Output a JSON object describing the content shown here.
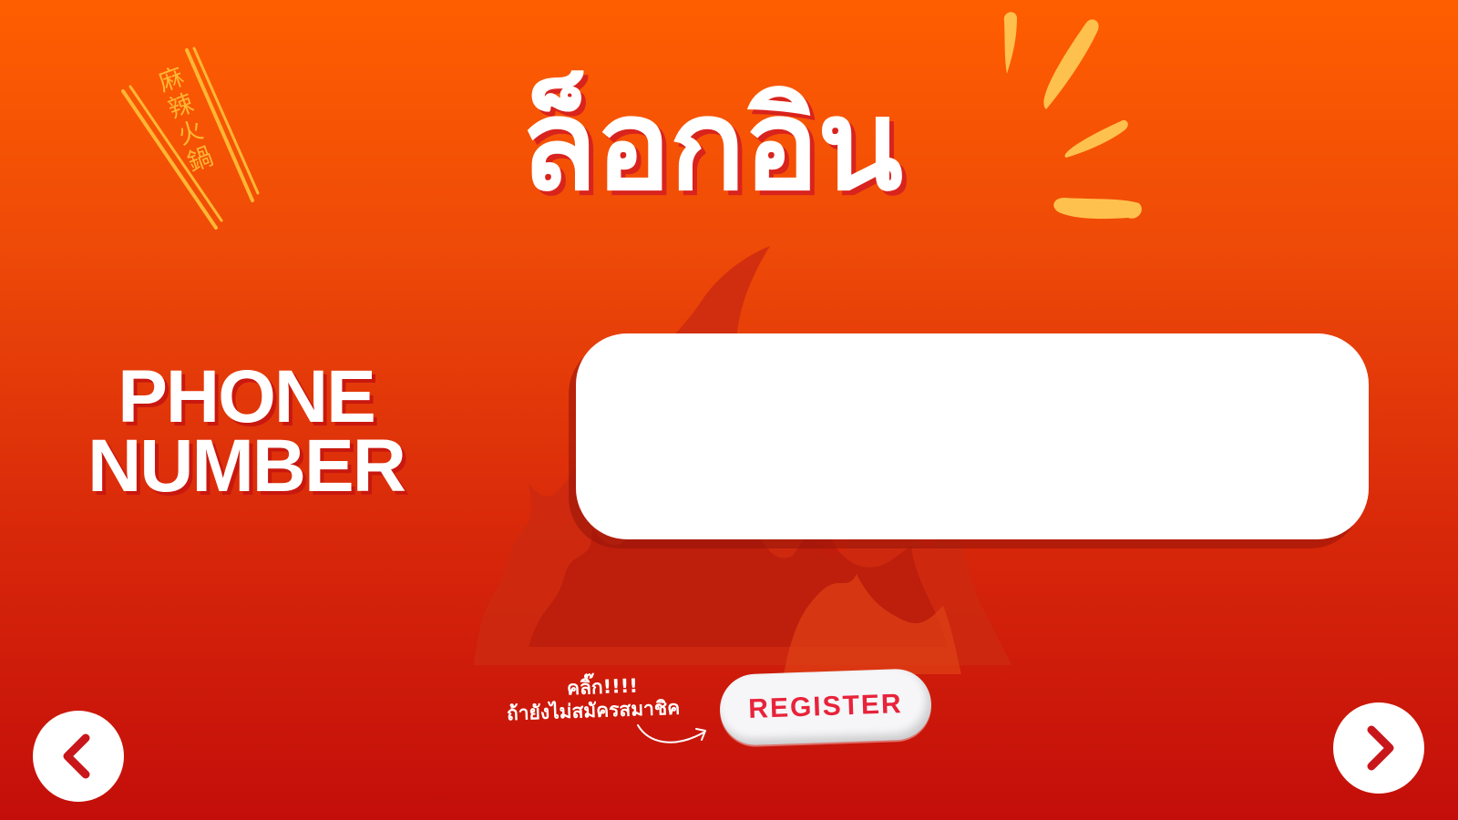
{
  "header": {
    "title": "ล็อกอิน",
    "logo_text": "麻辣火鍋"
  },
  "form": {
    "phone_label_line1": "PHONE",
    "phone_label_line2": "NUMBER",
    "phone_value": "",
    "phone_placeholder": ""
  },
  "register": {
    "hint_click": "คลิ๊ก!!!!",
    "hint_text": "ถ้ายังไม่สมัครสมาชิค",
    "button_label": "REGISTER"
  },
  "navigation": {
    "prev_icon": "chevron-left-icon",
    "next_icon": "chevron-right-icon"
  },
  "colors": {
    "background_top": "#ff5e00",
    "background_bottom": "#c30e0a",
    "accent": "#e8233a",
    "flame": "#c8210f",
    "burst": "#ffc14d"
  }
}
